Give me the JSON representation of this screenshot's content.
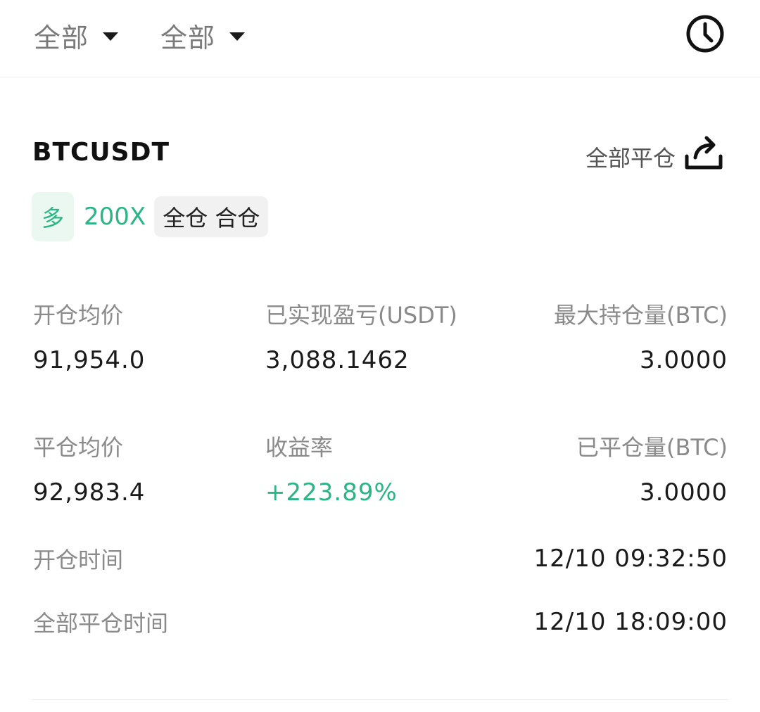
{
  "filters": [
    {
      "label": "全部"
    },
    {
      "label": "全部"
    }
  ],
  "position": {
    "symbol": "BTCUSDT",
    "close_all_label": "全部平仓",
    "side": "多",
    "leverage": "200X",
    "margin_mode": "全仓 合仓"
  },
  "stats": {
    "open_avg_price": {
      "label": "开仓均价",
      "value": "91,954.0"
    },
    "realized_pnl": {
      "label": "已实现盈亏(USDT)",
      "value": "3,088.1462"
    },
    "max_position": {
      "label": "最大持仓量(BTC)",
      "value": "3.0000"
    },
    "close_avg_price": {
      "label": "平仓均价",
      "value": "92,983.4"
    },
    "return_rate": {
      "label": "收益率",
      "value": "+223.89%"
    },
    "closed_amount": {
      "label": "已平仓量(BTC)",
      "value": "3.0000"
    }
  },
  "times": {
    "open_time": {
      "label": "开仓时间",
      "value": "12/10 09:32:50"
    },
    "close_time": {
      "label": "全部平仓时间",
      "value": "12/10 18:09:00"
    }
  },
  "icons": {
    "history": "clock-icon",
    "share": "share-icon"
  },
  "colors": {
    "accent_green": "#2bb584",
    "green_bg": "#eaf8f1",
    "muted_text": "#8a8a8a"
  }
}
